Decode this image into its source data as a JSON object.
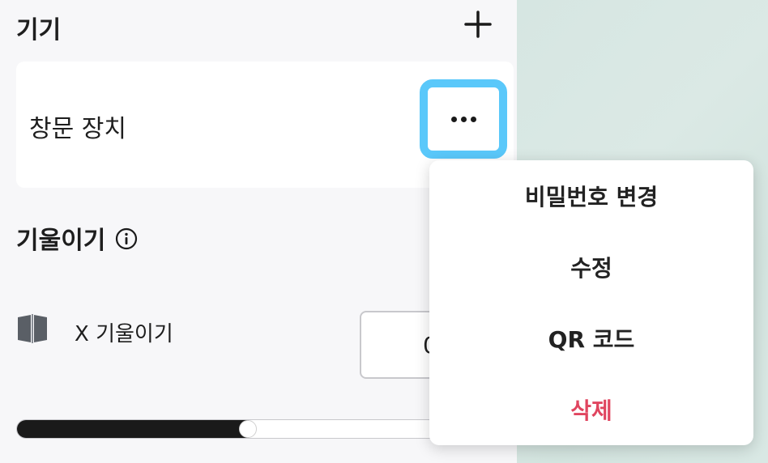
{
  "devices": {
    "title": "기기",
    "add_icon": "plus-icon",
    "card": {
      "name": "창문 장치",
      "more_icon": "ellipsis-icon"
    }
  },
  "tilt": {
    "title": "기울이기",
    "info_icon": "info-icon",
    "x_tilt": {
      "icon": "tilt-icon",
      "label": "X 기울이기",
      "value": "0",
      "slider_fraction": 0.51
    }
  },
  "context_menu": {
    "items": [
      {
        "label": "비밀번호 변경",
        "color": "#222222"
      },
      {
        "label": "수정",
        "color": "#222222"
      },
      {
        "label": "QR 코드",
        "color": "#222222"
      },
      {
        "label": "삭제",
        "color": "#e0455f"
      }
    ]
  },
  "colors": {
    "focus_ring": "#5ac8fa",
    "danger": "#e0455f",
    "map_background": "#d6e6e2"
  }
}
